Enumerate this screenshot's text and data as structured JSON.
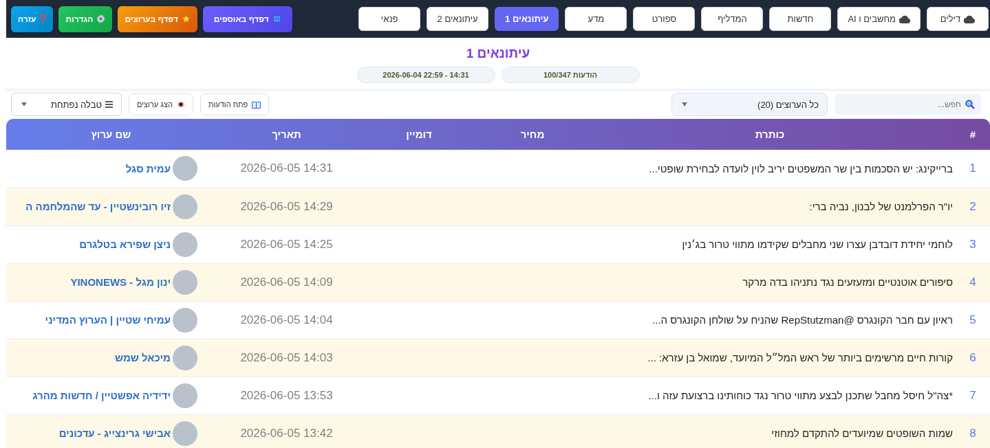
{
  "nav_tabs": [
    {
      "label": "דילים",
      "kind": "cloud",
      "selected": false
    },
    {
      "label": "מחשבים ו AI",
      "kind": "cloud",
      "selected": false
    },
    {
      "label": "חדשות",
      "kind": "plain",
      "selected": false
    },
    {
      "label": "המדליף",
      "kind": "plain",
      "selected": false
    },
    {
      "label": "ספורט",
      "kind": "plain",
      "selected": false
    },
    {
      "label": "מדע",
      "kind": "plain",
      "selected": false
    },
    {
      "label": "עיתונאים 1",
      "kind": "plain",
      "selected": true
    },
    {
      "label": "עיתונאים 2",
      "kind": "plain",
      "selected": false
    },
    {
      "label": "פנאי",
      "kind": "plain",
      "selected": false
    }
  ],
  "action_buttons": [
    {
      "label": "דפדף באוספים",
      "kind": "collections"
    },
    {
      "label": "דפדף בערוצים",
      "kind": "channels"
    },
    {
      "label": "הגדרות",
      "kind": "settings"
    },
    {
      "label": "עזרה",
      "kind": "help"
    }
  ],
  "header": {
    "title": "עיתונאים 1",
    "message_count": "הודעות 100/347",
    "time_range": "2026-06-04 22:59 - 14:31"
  },
  "toolbar": {
    "search": {
      "placeholder": "חפש..."
    },
    "channel_filter": {
      "value": "כל הערוצים (20)"
    },
    "open_messages_button": "פתח הודעות",
    "show_channels_button": "הצג ערוצים",
    "view_select": {
      "value": "טבלה נפתחת"
    }
  },
  "table": {
    "columns": [
      "#",
      "כותרת",
      "מחיר",
      "דומיין",
      "תאריך",
      "שם ערוץ"
    ],
    "rows": [
      {
        "number": "1",
        "title": "ברייקינג: יש הסכמות בין שר המשפטים יריב לוין לועדה לבחירת שופטי...",
        "date": "2026-06-05 14:31",
        "channel": "עמית סגל"
      },
      {
        "number": "2",
        "title": "יו\"ר הפרלמנט של לבנון, נביה ברי:",
        "date": "2026-06-05 14:29",
        "channel": "זיו רובינשטיין - עד שהמלחמה ה"
      },
      {
        "number": "3",
        "title": "לוחמי יחידת דובדבן עצרו שני מחבלים שקידמו מתווי טרור בג׳נין",
        "date": "2026-06-05 14:25",
        "channel": "ניצן שפירא בטלגרם"
      },
      {
        "number": "4",
        "title": "סיפורים אוטנטיים ומזעזעים נגד נתניהו בדה מרקר",
        "date": "2026-06-05 14:09",
        "channel": "ינון מגל - YINONEWS"
      },
      {
        "number": "5",
        "title": "ראיון עם חבר הקונגרס @RepStutzman שהניח על שולחן הקונגרס ה...",
        "date": "2026-06-05 14:04",
        "channel": "עמיחי שטיין | הערוץ המדיני"
      },
      {
        "number": "6",
        "title": "קורות חיים מרשימים ביותר של ראש המל״ל המיועד, שמואל בן עזרא: ...",
        "date": "2026-06-05 14:03",
        "channel": "מיכאל שמש"
      },
      {
        "number": "7",
        "title": "*צה\"ל חיסל מחבל שתכנן לבצע מתווי טרור נגד כוחותינו ברצועת עזה ו...",
        "date": "2026-06-05 13:53",
        "channel": "ידידיה אפשטיין / חדשות מהרג"
      },
      {
        "number": "8",
        "title": "שמות השופטים שמיועדים להתקדם למחוזי",
        "date": "2026-06-05 13:42",
        "channel": "אבישי גרינצייג - עדכונים"
      }
    ]
  }
}
